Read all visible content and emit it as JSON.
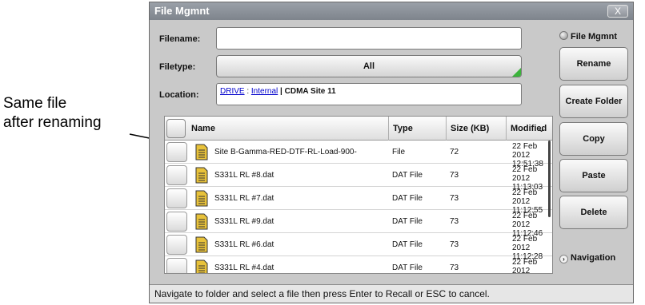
{
  "annotation": {
    "line1": "Same file",
    "line2": "after renaming"
  },
  "window": {
    "title": "File Mgmnt",
    "close_label": "X"
  },
  "form": {
    "filename_label": "Filename:",
    "filename_value": "",
    "filetype_label": "Filetype:",
    "filetype_value": "All",
    "location_label": "Location:",
    "location": {
      "drive": "DRIVE",
      "sep1": " : ",
      "internal": "Internal",
      "sep2": " | ",
      "folder": "CDMA Site 11"
    }
  },
  "table": {
    "columns": [
      "Name",
      "Type",
      "Size (KB)",
      "Modified"
    ],
    "sort_icon": "chevron-down-icon",
    "rows": [
      {
        "name": "Site B-Gamma-RED-DTF-RL-Load-900-",
        "type": "File",
        "size": "72",
        "date": "22 Feb 2012",
        "time": "12:51:38"
      },
      {
        "name": "S331L RL #8.dat",
        "type": "DAT File",
        "size": "73",
        "date": "22 Feb 2012",
        "time": "11:13:03"
      },
      {
        "name": "S331L RL #7.dat",
        "type": "DAT File",
        "size": "73",
        "date": "22 Feb 2012",
        "time": "11:12:55"
      },
      {
        "name": "S331L RL #9.dat",
        "type": "DAT File",
        "size": "73",
        "date": "22 Feb 2012",
        "time": "11:12:46"
      },
      {
        "name": "S331L RL #6.dat",
        "type": "DAT File",
        "size": "73",
        "date": "22 Feb 2012",
        "time": "11:12:28"
      },
      {
        "name": "S331L RL #4.dat",
        "type": "DAT File",
        "size": "73",
        "date": "22 Feb 2012",
        "time": "11:12:19"
      }
    ]
  },
  "sidebar": {
    "header": "File Mgmnt",
    "buttons": [
      "Rename",
      "Create Folder",
      "Copy",
      "Paste",
      "Delete"
    ],
    "nav_label": "Navigation"
  },
  "status": {
    "text": "Navigate to folder and select a file then press Enter to Recall or ESC to cancel."
  },
  "colors": {
    "titlebar": "#8a9098",
    "accent_green": "#3bb33b",
    "link": "#0000cc",
    "file_icon": "#e8c23a"
  }
}
